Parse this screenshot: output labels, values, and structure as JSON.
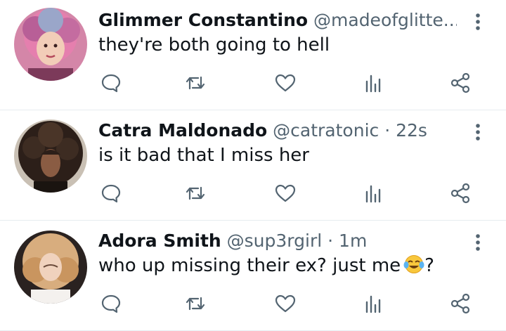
{
  "tweets": [
    {
      "name": "Glimmer Constantino",
      "handle": "@madeofglitte...",
      "dot": "",
      "time": "",
      "text": "they're both going to hell",
      "avatar_bg": "#c96a8e"
    },
    {
      "name": "Catra Maldonado",
      "handle": "@catratonic",
      "dot": "·",
      "time": "22s",
      "text": "is it bad that I miss her",
      "avatar_bg": "#3b2a22"
    },
    {
      "name": "Adora Smith",
      "handle": "@sup3rgirl",
      "dot": "·",
      "time": "1m",
      "text": "who up missing their ex? just me",
      "text_suffix": "?",
      "avatar_bg": "#d9b48a"
    }
  ],
  "icons": {
    "reply": "reply-icon",
    "retweet": "retweet-icon",
    "like": "heart-icon",
    "stats": "analytics-icon",
    "share": "share-icon",
    "more": "more-vertical-icon",
    "emoji": "face-with-tears-of-joy-emoji"
  },
  "colors": {
    "text_primary": "#0f1419",
    "text_secondary": "#536471",
    "icon": "#536471",
    "divider": "#e6ecf0"
  }
}
